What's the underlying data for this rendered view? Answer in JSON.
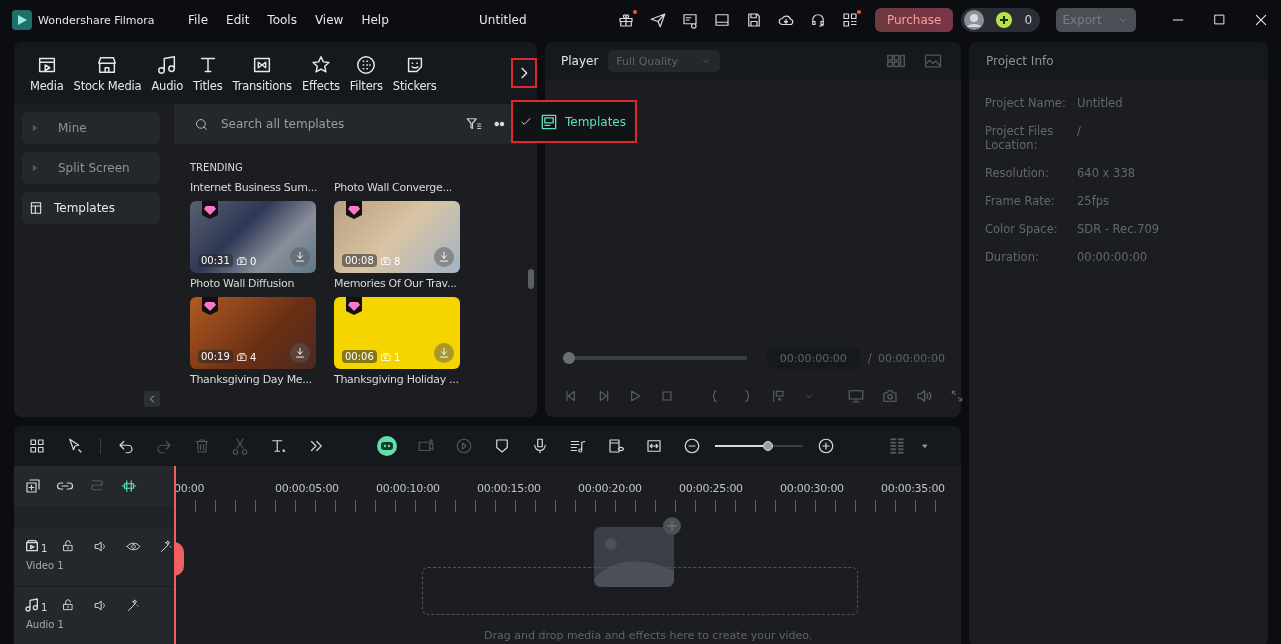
{
  "app": {
    "name": "Wondershare Filmora",
    "menu": [
      "File",
      "Edit",
      "Tools",
      "View",
      "Help"
    ],
    "title": "Untitled",
    "purchase": "Purchase",
    "credits": "0",
    "export": {
      "label": "Export",
      "disabled": true
    }
  },
  "media_tabs": [
    {
      "label": "Media",
      "selected": false
    },
    {
      "label": "Stock Media",
      "selected": false
    },
    {
      "label": "Audio",
      "selected": false
    },
    {
      "label": "Titles",
      "selected": false
    },
    {
      "label": "Transitions",
      "selected": false
    },
    {
      "label": "Effects",
      "selected": false
    },
    {
      "label": "Filters",
      "selected": false
    },
    {
      "label": "Stickers",
      "selected": false
    }
  ],
  "more_menu": {
    "items": [
      {
        "label": "Templates",
        "checked": true
      }
    ]
  },
  "sidebar": {
    "items": [
      {
        "label": "Mine",
        "kind": "group",
        "selected": false
      },
      {
        "label": "Split Screen",
        "kind": "group",
        "selected": false
      },
      {
        "label": "Templates",
        "kind": "item",
        "selected": true
      }
    ]
  },
  "search": {
    "placeholder": "Search all templates"
  },
  "section": "TRENDING",
  "partial_titles": [
    "Internet Business Sum...",
    "Photo Wall Converge..."
  ],
  "templates": [
    {
      "title": "Photo Wall Diffusion",
      "duration": "00:31",
      "clips": "0",
      "premium": true
    },
    {
      "title": "Memories Of Our Trav...",
      "duration": "00:08",
      "clips": "8",
      "premium": true
    },
    {
      "title": "Thanksgiving Day Me...",
      "duration": "00:19",
      "clips": "4",
      "premium": true
    },
    {
      "title": "Thanksgiving Holiday ...",
      "duration": "00:06",
      "clips": "1",
      "premium": true
    }
  ],
  "player": {
    "label": "Player",
    "quality": "Full Quality",
    "scrubber": {
      "level": 0
    },
    "current": "00:00:00:00",
    "separator": "/",
    "total": "00:00:00:00"
  },
  "project_info": {
    "title": "Project Info",
    "fields": [
      {
        "label": "Project Name:",
        "value": "Untitled"
      },
      {
        "label": "Project Files Location:",
        "value": "/"
      },
      {
        "label": "Resolution:",
        "value": "640 x 338"
      },
      {
        "label": "Frame Rate:",
        "value": "25fps"
      },
      {
        "label": "Color Space:",
        "value": "SDR - Rec.709"
      },
      {
        "label": "Duration:",
        "value": "00:00:00:00"
      }
    ]
  },
  "timeline": {
    "zoom": {
      "level": 0.6
    },
    "ruler": [
      "00:00",
      "00:00:05:00",
      "00:00:10:00",
      "00:00:15:00",
      "00:00:20:00",
      "00:00:25:00",
      "00:00:30:00",
      "00:00:35:00"
    ],
    "tracks": [
      {
        "kind": "video",
        "number": "1",
        "name": "Video 1"
      },
      {
        "kind": "audio",
        "number": "1",
        "name": "Audio 1"
      }
    ],
    "drop_hint": "Drag and drop media and effects here to create your video."
  }
}
